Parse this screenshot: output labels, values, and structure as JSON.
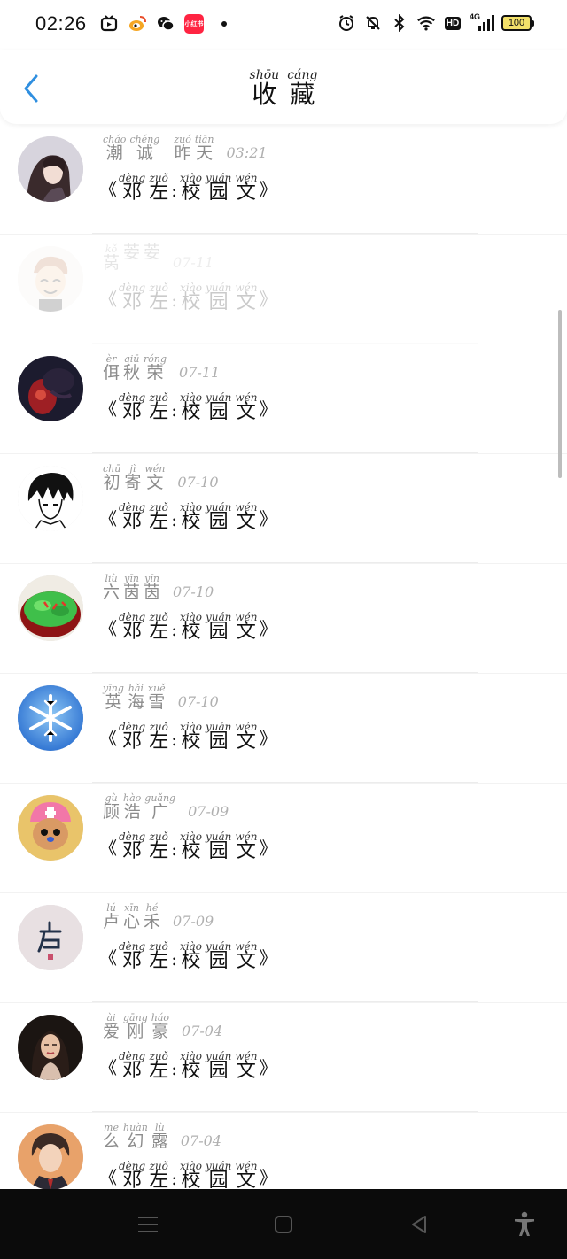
{
  "status_bar": {
    "time": "02:26",
    "battery": "100",
    "left_icons": [
      "video-app-icon",
      "weibo-icon",
      "wechat-icon",
      "xiaohongshu-icon",
      "notification-dot"
    ],
    "red_app_label": "小红书",
    "right_icons": [
      "alarm-icon",
      "mute-icon",
      "bluetooth-icon",
      "wifi-icon",
      "hd-icon",
      "signal-4g-icon",
      "battery-icon"
    ],
    "hd_label": "HD",
    "network_label": "4G"
  },
  "header": {
    "title": [
      {
        "py": "shōu",
        "hz": "收"
      },
      {
        "py": "cáng",
        "hz": "藏"
      }
    ],
    "accent": "#2f8fe0"
  },
  "items": [
    {
      "avatar": "dark-hair-girl-avatar",
      "name": [
        {
          "py": "cháo",
          "hz": "潮"
        },
        {
          "py": "chéng",
          "hz": "诚"
        }
      ],
      "time_parts": [
        {
          "py": "zuó",
          "hz": "昨"
        },
        {
          "py": "tiān",
          "hz": "天"
        }
      ],
      "time": "03:21",
      "faded": false,
      "book_open": "《",
      "book": [
        {
          "py": "dèng",
          "hz": "邓"
        },
        {
          "py": "zuǒ",
          "hz": "左"
        }
      ],
      "book_sep": ":",
      "book2": [
        {
          "py": "xiào",
          "hz": "校"
        },
        {
          "py": "yuán",
          "hz": "园"
        },
        {
          "py": "wén",
          "hz": "文"
        }
      ],
      "book_close": "》"
    },
    {
      "avatar": "cartoon-man-avatar",
      "name": [
        {
          "py": "kǒ",
          "hz": "莴"
        },
        {
          "py": "",
          "hz": "荌"
        },
        {
          "py": "",
          "hz": "荌"
        }
      ],
      "time_parts": [],
      "time": "07-11",
      "faded": true,
      "book_open": "《",
      "book": [
        {
          "py": "dèng",
          "hz": "邓"
        },
        {
          "py": "zuǒ",
          "hz": "左"
        }
      ],
      "book_sep": ":",
      "book2": [
        {
          "py": "xiào",
          "hz": "校"
        },
        {
          "py": "yuán",
          "hz": "园"
        },
        {
          "py": "wén",
          "hz": "文"
        }
      ],
      "book_close": "》"
    },
    {
      "avatar": "dark-red-photo-avatar",
      "name": [
        {
          "py": "èr",
          "hz": "佴"
        },
        {
          "py": "qiū",
          "hz": "秋"
        },
        {
          "py": "róng",
          "hz": "荣"
        }
      ],
      "time_parts": [],
      "time": "07-11",
      "faded": false,
      "book_open": "《",
      "book": [
        {
          "py": "dèng",
          "hz": "邓"
        },
        {
          "py": "zuǒ",
          "hz": "左"
        }
      ],
      "book_sep": ":",
      "book2": [
        {
          "py": "xiào",
          "hz": "校"
        },
        {
          "py": "yuán",
          "hz": "园"
        },
        {
          "py": "wén",
          "hz": "文"
        }
      ],
      "book_close": "》"
    },
    {
      "avatar": "anime-boy-sketch-avatar",
      "name": [
        {
          "py": "chū",
          "hz": "初"
        },
        {
          "py": "jì",
          "hz": "寄"
        },
        {
          "py": "wén",
          "hz": "文"
        }
      ],
      "time_parts": [],
      "time": "07-10",
      "faded": false,
      "book_open": "《",
      "book": [
        {
          "py": "dèng",
          "hz": "邓"
        },
        {
          "py": "zuǒ",
          "hz": "左"
        }
      ],
      "book_sep": ":",
      "book2": [
        {
          "py": "xiào",
          "hz": "校"
        },
        {
          "py": "yuán",
          "hz": "园"
        },
        {
          "py": "wén",
          "hz": "文"
        }
      ],
      "book_close": "》"
    },
    {
      "avatar": "salad-bowl-avatar",
      "name": [
        {
          "py": "liù",
          "hz": "六"
        },
        {
          "py": "yīn",
          "hz": "茵"
        },
        {
          "py": "yīn",
          "hz": "茵"
        }
      ],
      "time_parts": [],
      "time": "07-10",
      "faded": false,
      "book_open": "《",
      "book": [
        {
          "py": "dèng",
          "hz": "邓"
        },
        {
          "py": "zuǒ",
          "hz": "左"
        }
      ],
      "book_sep": ":",
      "book2": [
        {
          "py": "xiào",
          "hz": "校"
        },
        {
          "py": "yuán",
          "hz": "园"
        },
        {
          "py": "wén",
          "hz": "文"
        }
      ],
      "book_close": "》"
    },
    {
      "avatar": "snowflake-avatar",
      "name": [
        {
          "py": "yīng",
          "hz": "英"
        },
        {
          "py": "hǎi",
          "hz": "海"
        },
        {
          "py": "xuě",
          "hz": "雪"
        }
      ],
      "time_parts": [],
      "time": "07-10",
      "faded": false,
      "book_open": "《",
      "book": [
        {
          "py": "dèng",
          "hz": "邓"
        },
        {
          "py": "zuǒ",
          "hz": "左"
        }
      ],
      "book_sep": ":",
      "book2": [
        {
          "py": "xiào",
          "hz": "校"
        },
        {
          "py": "yuán",
          "hz": "园"
        },
        {
          "py": "wén",
          "hz": "文"
        }
      ],
      "book_close": "》"
    },
    {
      "avatar": "chopper-cartoon-avatar",
      "name": [
        {
          "py": "gù",
          "hz": "顾"
        },
        {
          "py": "hào",
          "hz": "浩"
        },
        {
          "py": "guǎng",
          "hz": "广"
        }
      ],
      "time_parts": [],
      "time": "07-09",
      "faded": false,
      "book_open": "《",
      "book": [
        {
          "py": "dèng",
          "hz": "邓"
        },
        {
          "py": "zuǒ",
          "hz": "左"
        }
      ],
      "book_sep": ":",
      "book2": [
        {
          "py": "xiào",
          "hz": "校"
        },
        {
          "py": "yuán",
          "hz": "园"
        },
        {
          "py": "wén",
          "hz": "文"
        }
      ],
      "book_close": "》"
    },
    {
      "avatar": "calligraphy-lu-avatar",
      "name": [
        {
          "py": "lú",
          "hz": "卢"
        },
        {
          "py": "xīn",
          "hz": "心"
        },
        {
          "py": "hé",
          "hz": "禾"
        }
      ],
      "time_parts": [],
      "time": "07-09",
      "faded": false,
      "book_open": "《",
      "book": [
        {
          "py": "dèng",
          "hz": "邓"
        },
        {
          "py": "zuǒ",
          "hz": "左"
        }
      ],
      "book_sep": ":",
      "book2": [
        {
          "py": "xiào",
          "hz": "校"
        },
        {
          "py": "yuán",
          "hz": "园"
        },
        {
          "py": "wén",
          "hz": "文"
        }
      ],
      "book_close": "》"
    },
    {
      "avatar": "woman-portrait-avatar",
      "name": [
        {
          "py": "ài",
          "hz": "爱"
        },
        {
          "py": "gāng",
          "hz": "刚"
        },
        {
          "py": "háo",
          "hz": "豪"
        }
      ],
      "time_parts": [],
      "time": "07-04",
      "faded": false,
      "book_open": "《",
      "book": [
        {
          "py": "dèng",
          "hz": "邓"
        },
        {
          "py": "zuǒ",
          "hz": "左"
        }
      ],
      "book_sep": ":",
      "book2": [
        {
          "py": "xiào",
          "hz": "校"
        },
        {
          "py": "yuán",
          "hz": "园"
        },
        {
          "py": "wén",
          "hz": "文"
        }
      ],
      "book_close": "》"
    },
    {
      "avatar": "anime-man-suit-avatar",
      "name": [
        {
          "py": "me",
          "hz": "么"
        },
        {
          "py": "huàn",
          "hz": "幻"
        },
        {
          "py": "lù",
          "hz": "露"
        }
      ],
      "time_parts": [],
      "time": "07-04",
      "faded": false,
      "book_open": "《",
      "book": [
        {
          "py": "dèng",
          "hz": "邓"
        },
        {
          "py": "zuǒ",
          "hz": "左"
        }
      ],
      "book_sep": ":",
      "book2": [
        {
          "py": "xiào",
          "hz": "校"
        },
        {
          "py": "yuán",
          "hz": "园"
        },
        {
          "py": "wén",
          "hz": "文"
        }
      ],
      "book_close": "》"
    }
  ],
  "nav_bar": {
    "buttons": [
      "menu-icon",
      "home-icon",
      "back-triangle-icon",
      "accessibility-icon"
    ]
  }
}
